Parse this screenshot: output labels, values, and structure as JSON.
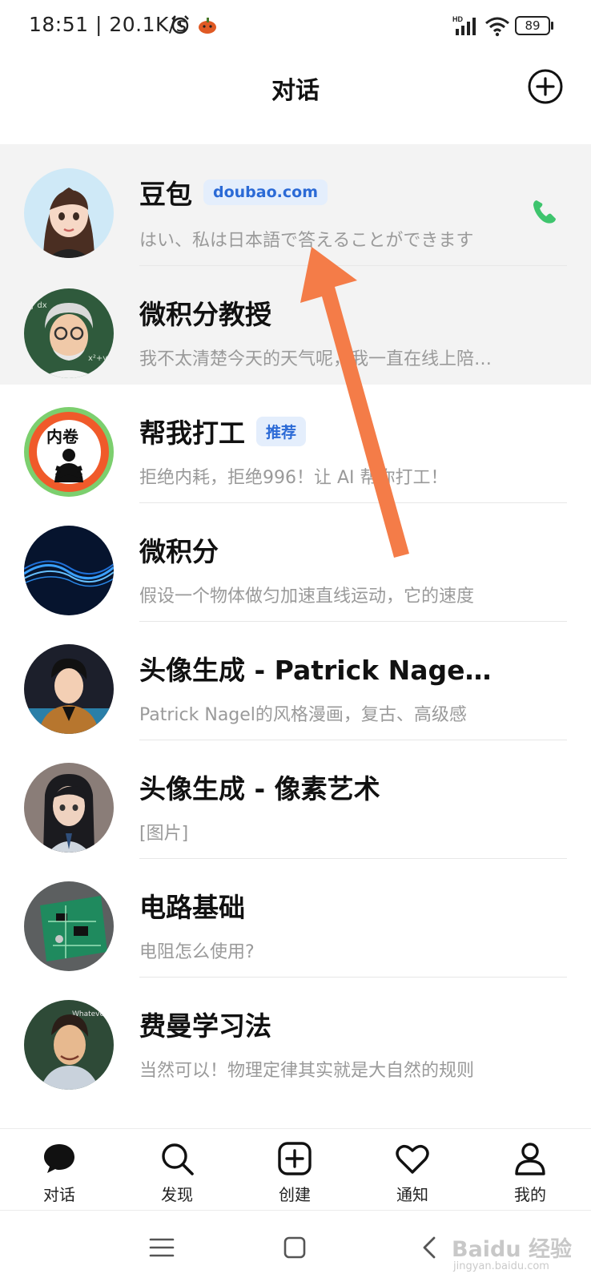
{
  "status_bar": {
    "time_speed": "18:51 | 20.1K/s",
    "battery": "89",
    "network": "HD"
  },
  "header": {
    "title": "对话"
  },
  "chats": [
    {
      "name": "豆包",
      "badge": "doubao.com",
      "preview": "はい、私は日本語で答えることができます",
      "pinned": true,
      "avatar": "girl-avatar",
      "has_call": true
    },
    {
      "name": "微积分教授",
      "badge": "",
      "preview": "我不太清楚今天的天气呢，我一直在线上陪你学习",
      "pinned": true,
      "avatar": "professor-avatar"
    },
    {
      "name": "帮我打工",
      "badge": "推荐",
      "preview": "拒绝内耗，拒绝996！让 AI 帮你打工！",
      "pinned": false,
      "avatar": "work-sign-avatar"
    },
    {
      "name": "微积分",
      "badge": "",
      "preview": "假设一个物体做匀加速直线运动，它的速度",
      "pinned": false,
      "avatar": "blue-wave-avatar"
    },
    {
      "name": "头像生成 - Patrick Nagel风格",
      "badge": "",
      "preview": "Patrick Nagel的风格漫画，复古、高级感",
      "pinned": false,
      "avatar": "man-portrait-avatar"
    },
    {
      "name": "头像生成 - 像素艺术",
      "badge": "",
      "preview": "[图片]",
      "pinned": false,
      "avatar": "pixel-girl-avatar"
    },
    {
      "name": "电路基础",
      "badge": "",
      "preview": "电阻怎么使用?",
      "pinned": false,
      "avatar": "circuit-board-avatar"
    },
    {
      "name": "费曼学习法",
      "badge": "",
      "preview": "当然可以！物理定律其实就是大自然的规则",
      "pinned": false,
      "avatar": "feynman-avatar"
    }
  ],
  "bottom_nav": [
    {
      "label": "对话",
      "icon": "chat-bubble-icon",
      "active": true
    },
    {
      "label": "发现",
      "icon": "search-icon",
      "active": false
    },
    {
      "label": "创建",
      "icon": "plus-square-icon",
      "active": false
    },
    {
      "label": "通知",
      "icon": "heart-icon",
      "active": false
    },
    {
      "label": "我的",
      "icon": "person-icon",
      "active": false
    }
  ],
  "watermark": {
    "main": "Baidu 经验",
    "sub": "jingyan.baidu.com"
  },
  "colors": {
    "accent": "#2b6ad6",
    "call_green": "#3ec46d",
    "arrow": "#f47c48",
    "pinned_bg": "#f3f3f3"
  }
}
